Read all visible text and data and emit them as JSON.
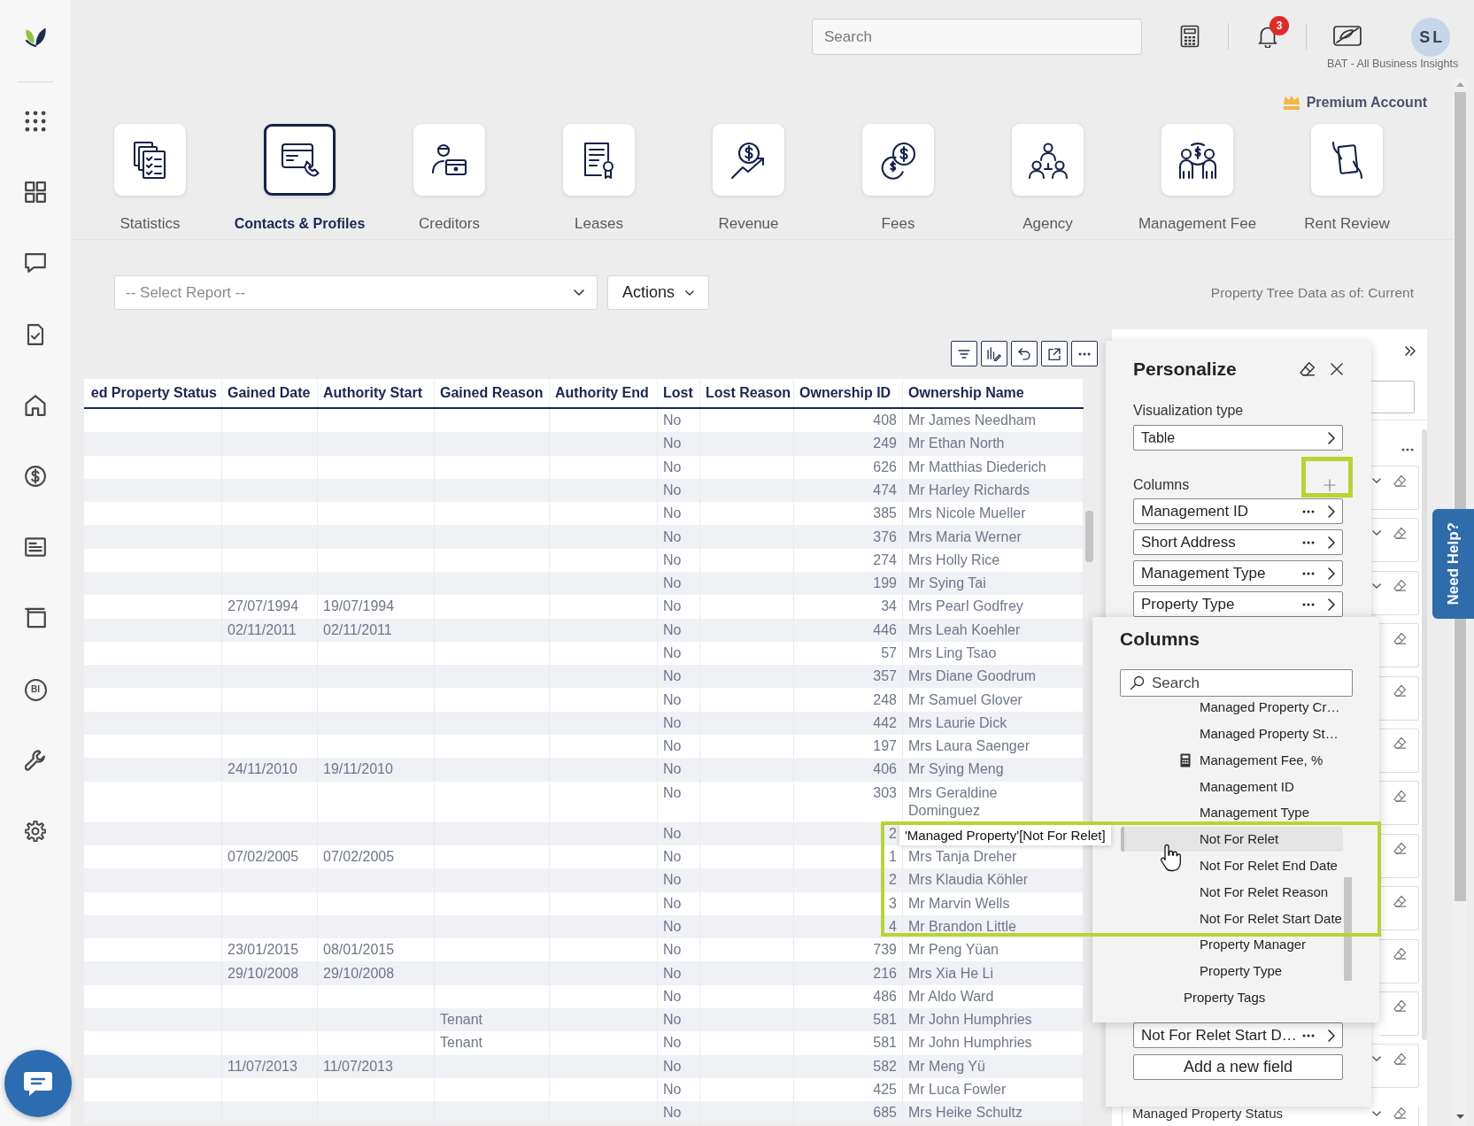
{
  "sidebar": {
    "items": [
      {
        "kind": "apps"
      },
      {
        "kind": "dashboard"
      },
      {
        "kind": "messages"
      },
      {
        "kind": "tasks"
      },
      {
        "kind": "home"
      },
      {
        "kind": "finance"
      },
      {
        "kind": "reports"
      },
      {
        "kind": "board"
      },
      {
        "kind": "bi",
        "label": "BI"
      },
      {
        "kind": "tools"
      },
      {
        "kind": "settings"
      }
    ]
  },
  "top_bar": {
    "search": {
      "placeholder": "Search"
    },
    "notifications": {
      "count": "3"
    },
    "avatar": {
      "initials": "SL"
    },
    "account": "BAT - All Business Insights"
  },
  "premium": {
    "label": "Premium Account"
  },
  "modules": [
    {
      "label": "Statistics",
      "kind": "documents",
      "selected": false
    },
    {
      "label": "Contacts & Profiles",
      "kind": "card",
      "selected": true
    },
    {
      "label": "Creditors",
      "kind": "person",
      "selected": false
    },
    {
      "label": "Leases",
      "kind": "certificate",
      "selected": false
    },
    {
      "label": "Revenue",
      "kind": "growth",
      "selected": false
    },
    {
      "label": "Fees",
      "kind": "coins",
      "selected": false
    },
    {
      "label": "Agency",
      "kind": "team",
      "selected": false
    },
    {
      "label": "Management Fee",
      "kind": "exchange",
      "selected": false
    },
    {
      "label": "Rent Review",
      "kind": "handover",
      "selected": false
    }
  ],
  "report_bar": {
    "report_select": {
      "placeholder": "-- Select Report --"
    },
    "actions": "Actions",
    "data_as_of": "Property Tree Data as of: Current"
  },
  "table": {
    "toolbar": [
      {
        "kind": "filter"
      },
      {
        "kind": "chart"
      },
      {
        "kind": "undo"
      },
      {
        "kind": "expand"
      },
      {
        "kind": "more"
      }
    ],
    "columns": [
      {
        "label": "ed Property Status",
        "kind": "text"
      },
      {
        "label": "Gained Date",
        "kind": "text"
      },
      {
        "label": "Authority Start",
        "kind": "text"
      },
      {
        "label": "Gained Reason",
        "kind": "text"
      },
      {
        "label": "Authority End",
        "kind": "text"
      },
      {
        "label": "Lost",
        "kind": "text"
      },
      {
        "label": "Lost Reason",
        "kind": "text"
      },
      {
        "label": "Ownership ID",
        "kind": "number"
      },
      {
        "label": "Ownership Name",
        "kind": "text"
      }
    ],
    "rows": [
      {
        "lost": "No",
        "ownership_id": "408",
        "ownership_name": "Mr James Needham"
      },
      {
        "lost": "No",
        "ownership_id": "249",
        "ownership_name": "Mr Ethan North"
      },
      {
        "lost": "No",
        "ownership_id": "626",
        "ownership_name": "Mr Matthias Diederich"
      },
      {
        "lost": "No",
        "ownership_id": "474",
        "ownership_name": "Mr Harley Richards"
      },
      {
        "lost": "No",
        "ownership_id": "385",
        "ownership_name": "Mrs Nicole Mueller"
      },
      {
        "lost": "No",
        "ownership_id": "376",
        "ownership_name": "Mrs Maria Werner"
      },
      {
        "lost": "No",
        "ownership_id": "274",
        "ownership_name": "Mrs Holly Rice"
      },
      {
        "lost": "No",
        "ownership_id": "199",
        "ownership_name": "Mr Sying Tai"
      },
      {
        "gained_date": "27/07/1994",
        "authority_start": "19/07/1994",
        "lost": "No",
        "ownership_id": "34",
        "ownership_name": "Mrs Pearl Godfrey"
      },
      {
        "gained_date": "02/11/2011",
        "authority_start": "02/11/2011",
        "lost": "No",
        "ownership_id": "446",
        "ownership_name": "Mrs Leah Koehler"
      },
      {
        "lost": "No",
        "ownership_id": "57",
        "ownership_name": "Mrs Ling Tsao"
      },
      {
        "lost": "No",
        "ownership_id": "357",
        "ownership_name": "Mrs Diane Goodrum"
      },
      {
        "lost": "No",
        "ownership_id": "248",
        "ownership_name": "Mr Samuel Glover"
      },
      {
        "lost": "No",
        "ownership_id": "442",
        "ownership_name": "Mrs Laurie Dick"
      },
      {
        "lost": "No",
        "ownership_id": "197",
        "ownership_name": "Mrs Laura Saenger"
      },
      {
        "gained_date": "24/11/2010",
        "authority_start": "19/11/2010",
        "lost": "No",
        "ownership_id": "406",
        "ownership_name": "Mr Sying Meng"
      },
      {
        "lost": "No",
        "ownership_id": "303",
        "ownership_name": "Mrs Geraldine Dominguez"
      },
      {
        "lost": "No",
        "ownership_id": "2"
      },
      {
        "gained_date": "07/02/2005",
        "authority_start": "07/02/2005",
        "lost": "No",
        "ownership_id": "1",
        "ownership_name": "Mrs Tanja Dreher"
      },
      {
        "lost": "No",
        "ownership_id": "2",
        "ownership_name": "Mrs Klaudia Köhler"
      },
      {
        "lost": "No",
        "ownership_id": "3",
        "ownership_name": "Mr Marvin Wells"
      },
      {
        "lost": "No",
        "ownership_id": "4",
        "ownership_name": "Mr Brandon Little"
      },
      {
        "gained_date": "23/01/2015",
        "authority_start": "08/01/2015",
        "lost": "No",
        "ownership_id": "739",
        "ownership_name": "Mr Peng Yüan"
      },
      {
        "gained_date": "29/10/2008",
        "authority_start": "29/10/2008",
        "lost": "No",
        "ownership_id": "216",
        "ownership_name": "Mrs Xia He Li"
      },
      {
        "lost": "No",
        "ownership_id": "486",
        "ownership_name": "Mr Aldo Ward"
      },
      {
        "gained_reason": "Tenant",
        "lost": "No",
        "ownership_id": "581",
        "ownership_name": "Mr John Humphries"
      },
      {
        "gained_reason": "Tenant",
        "lost": "No",
        "ownership_id": "581",
        "ownership_name": "Mr John Humphries"
      },
      {
        "gained_date": "11/07/2013",
        "authority_start": "11/07/2013",
        "lost": "No",
        "ownership_id": "582",
        "ownership_name": "Mr Meng Yü"
      },
      {
        "lost": "No",
        "ownership_id": "425",
        "ownership_name": "Mr Luca Fowler"
      },
      {
        "lost": "No",
        "ownership_id": "685",
        "ownership_name": "Mrs Heike Schultz"
      }
    ]
  },
  "filter_pane": {
    "card_label": "Managed Property Status"
  },
  "personalize": {
    "title": "Personalize",
    "visualization": {
      "label": "Visualization type",
      "value": "Table"
    },
    "columns": {
      "label": "Columns",
      "items": [
        "Management ID",
        "Short Address",
        "Management Type",
        "Property Type",
        "Not For Relet Start D…"
      ],
      "add_button": "Add a new field"
    }
  },
  "column_picker": {
    "title": "Columns",
    "search": {
      "placeholder": "Search"
    },
    "items": [
      {
        "label": "Managed Property Cr…",
        "kind": "field",
        "hovered": false
      },
      {
        "label": "Managed Property St…",
        "kind": "field",
        "hovered": false
      },
      {
        "label": "Management Fee, %",
        "kind": "measure",
        "hovered": false
      },
      {
        "label": "Management ID",
        "kind": "field",
        "hovered": false
      },
      {
        "label": "Management Type",
        "kind": "field",
        "hovered": false
      },
      {
        "label": "Not For Relet",
        "kind": "field",
        "hovered": true
      },
      {
        "label": "Not For Relet End Date",
        "kind": "field",
        "hovered": false
      },
      {
        "label": "Not For Relet Reason",
        "kind": "field",
        "hovered": false
      },
      {
        "label": "Not For Relet Start Date",
        "kind": "field",
        "hovered": false
      },
      {
        "label": "Property Manager",
        "kind": "field",
        "hovered": false
      },
      {
        "label": "Property Type",
        "kind": "field",
        "hovered": false
      },
      {
        "label": "Property Tags",
        "kind": "table",
        "hovered": false
      }
    ],
    "tooltip": "'Managed Property'[Not For Relet]"
  },
  "need_help": "Need Help?"
}
